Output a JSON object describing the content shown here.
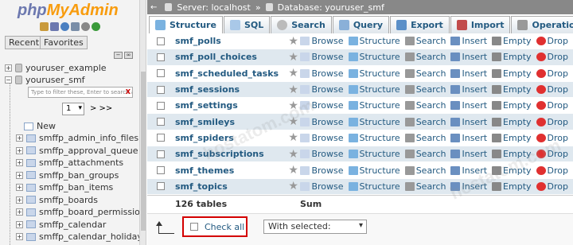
{
  "logo": {
    "part1": "php",
    "part2": "MyAdmin"
  },
  "nav": {
    "recent": "Recent",
    "favorites": "Favorites"
  },
  "tree": {
    "db1": "youruser_example",
    "db2": "youruser_smf",
    "filter_placeholder": "Type to filter these, Enter to search all",
    "page": "1",
    "next": "> >>",
    "new": "New",
    "tables": [
      "smffp_admin_info_files",
      "smffp_approval_queue",
      "smffp_attachments",
      "smffp_ban_groups",
      "smffp_ban_items",
      "smffp_boards",
      "smffp_board_permissions",
      "smffp_calendar",
      "smffp_calendar_holidays"
    ]
  },
  "breadcrumb": {
    "server": "Server: localhost",
    "sep": "»",
    "database": "Database: youruser_smf"
  },
  "tabs": [
    "Structure",
    "SQL",
    "Search",
    "Query",
    "Export",
    "Import",
    "Operations"
  ],
  "actions": {
    "browse": "Browse",
    "structure": "Structure",
    "search": "Search",
    "insert": "Insert",
    "empty": "Empty",
    "drop": "Drop"
  },
  "tables": [
    "smf_polls",
    "smf_poll_choices",
    "smf_scheduled_tasks",
    "smf_sessions",
    "smf_settings",
    "smf_smileys",
    "smf_spiders",
    "smf_subscriptions",
    "smf_themes",
    "smf_topics"
  ],
  "summary": {
    "count": "126 tables",
    "sum": "Sum"
  },
  "footer": {
    "check_all": "Check all",
    "with_selected": "With selected:"
  },
  "watermark": "hostatom.com"
}
